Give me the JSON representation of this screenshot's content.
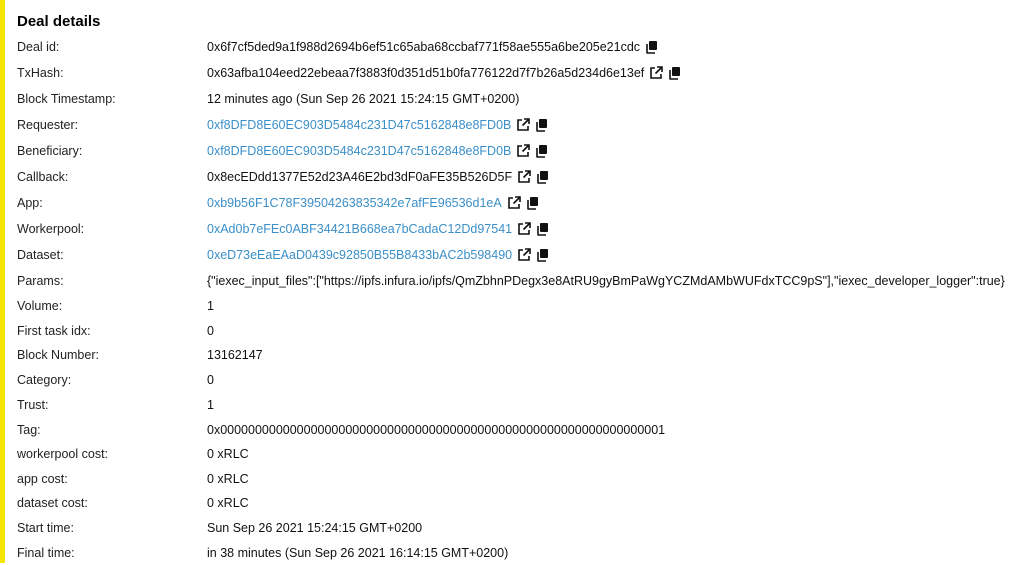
{
  "accent_color": "#f5e600",
  "link_color": "#3b8fc8",
  "title": "Deal details",
  "rows": [
    {
      "label": "Deal id:",
      "value": "0x6f7cf5ded9a1f988d2694b6ef51c65aba68ccbaf771f58ae555a6be205e21cdc",
      "link": false,
      "icons": [
        "copy-icon"
      ]
    },
    {
      "label": "TxHash:",
      "value": "0x63afba104eed22ebeaa7f3883f0d351d51b0fa776122d7f7b26a5d234d6e13ef",
      "link": false,
      "icons": [
        "external-link-icon",
        "copy-icon"
      ]
    },
    {
      "label": "Block Timestamp:",
      "value": "12 minutes ago (Sun Sep 26 2021 15:24:15 GMT+0200)",
      "link": false,
      "icons": []
    },
    {
      "label": "Requester:",
      "value": "0xf8DFD8E60EC903D5484c231D47c5162848e8FD0B",
      "link": true,
      "icons": [
        "external-link-icon",
        "copy-icon"
      ]
    },
    {
      "label": "Beneficiary:",
      "value": "0xf8DFD8E60EC903D5484c231D47c5162848e8FD0B",
      "link": true,
      "icons": [
        "external-link-icon",
        "copy-icon"
      ]
    },
    {
      "label": "Callback:",
      "value": "0x8ecEDdd1377E52d23A46E2bd3dF0aFE35B526D5F",
      "link": false,
      "icons": [
        "external-link-icon",
        "copy-icon"
      ]
    },
    {
      "label": "App:",
      "value": "0xb9b56F1C78F39504263835342e7afFE96536d1eA",
      "link": true,
      "icons": [
        "external-link-icon",
        "copy-icon"
      ]
    },
    {
      "label": "Workerpool:",
      "value": "0xAd0b7eFEc0ABF34421B668ea7bCadaC12Dd97541",
      "link": true,
      "icons": [
        "external-link-icon",
        "copy-icon"
      ]
    },
    {
      "label": "Dataset:",
      "value": "0xeD73eEaEAaD0439c92850B55B8433bAC2b598490",
      "link": true,
      "icons": [
        "external-link-icon",
        "copy-icon"
      ]
    },
    {
      "label": "Params:",
      "value": "{\"iexec_input_files\":[\"https://ipfs.infura.io/ipfs/QmZbhnPDegx3e8AtRU9gyBmPaWgYCZMdAMbWUFdxTCC9pS\"],\"iexec_developer_logger\":true}",
      "link": false,
      "icons": []
    },
    {
      "label": "Volume:",
      "value": "1",
      "link": false,
      "icons": []
    },
    {
      "label": "First task idx:",
      "value": "0",
      "link": false,
      "icons": []
    },
    {
      "label": "Block Number:",
      "value": "13162147",
      "link": false,
      "icons": []
    },
    {
      "label": "Category:",
      "value": "0",
      "link": false,
      "icons": []
    },
    {
      "label": "Trust:",
      "value": "1",
      "link": false,
      "icons": []
    },
    {
      "label": "Tag:",
      "value": "0x0000000000000000000000000000000000000000000000000000000000000001",
      "link": false,
      "icons": []
    },
    {
      "label": "workerpool cost:",
      "value": "0 xRLC",
      "link": false,
      "icons": []
    },
    {
      "label": "app cost:",
      "value": "0 xRLC",
      "link": false,
      "icons": []
    },
    {
      "label": "dataset cost:",
      "value": "0 xRLC",
      "link": false,
      "icons": []
    },
    {
      "label": "Start time:",
      "value": "Sun Sep 26 2021 15:24:15 GMT+0200",
      "link": false,
      "icons": []
    },
    {
      "label": "Final time:",
      "value": "in 38 minutes (Sun Sep 26 2021 16:14:15 GMT+0200)",
      "link": false,
      "icons": []
    }
  ]
}
